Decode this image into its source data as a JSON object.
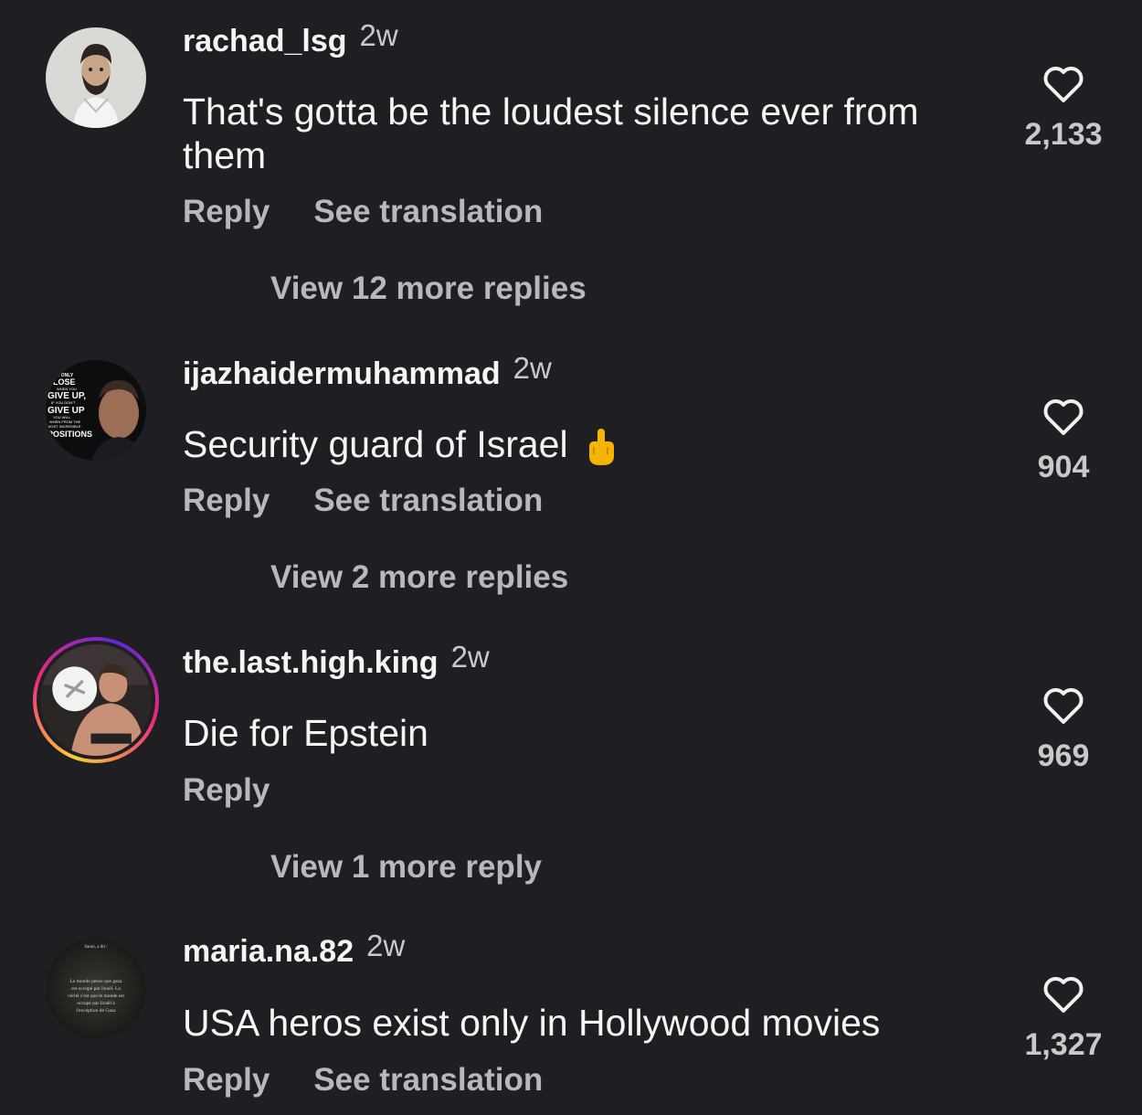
{
  "comments": [
    {
      "username": "rachad_lsg",
      "time": "2w",
      "text": "That's gotta be the loudest silence ever from them",
      "reply_label": "Reply",
      "translate_label": "See translation",
      "likes": "2,133",
      "more_replies": "View 12 more replies"
    },
    {
      "username": "ijazhaidermuhammad",
      "time": "2w",
      "text": "Security guard of Israel",
      "emoji": "middle-finger-emoji",
      "reply_label": "Reply",
      "translate_label": "See translation",
      "likes": "904",
      "more_replies": "View 2 more replies",
      "avatar_text": [
        "I ONLY",
        "LOSE",
        "WHEN YOU",
        "GIVE UP,",
        "IF YOU DON'T",
        "GIVE UP",
        "YOU WILL",
        "WHEN FROM THE",
        "MOST INCREDIBLE",
        "POSITIONS"
      ]
    },
    {
      "username": "the.last.high.king",
      "time": "2w",
      "text": "Die for Epstein",
      "reply_label": "Reply",
      "likes": "969",
      "more_replies": "View 1 more reply"
    },
    {
      "username": "maria.na.82",
      "time": "2w",
      "text": "USA heros exist only in Hollywood movies",
      "reply_label": "Reply",
      "translate_label": "See translation",
      "likes": "1,327",
      "avatar_text": [
        "Saoui, a dit :",
        "Le monde pense que gaza",
        "est occupé par Israël. La",
        "vérité c'est que le monde est",
        "occupé par Israël à",
        "l'exception de Gaza"
      ]
    }
  ],
  "colors": {
    "background": "#1f1f23",
    "primary_text": "#f5f5f5",
    "secondary_text": "#b8b8bc"
  },
  "icons": {
    "like": "heart-outline-icon"
  }
}
